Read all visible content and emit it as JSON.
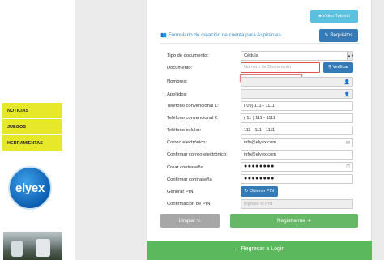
{
  "menu": {
    "items": [
      "NOTICIAS",
      "JUEGOS",
      "HERRAMIENTAS"
    ]
  },
  "logo": {
    "text": "elyex"
  },
  "header": {
    "video_label": "Video Tutorial",
    "title": "Formulario de creación de cuenta para Aspirantes",
    "requisitos_label": "Requisitos"
  },
  "form": {
    "tipo_documento": {
      "label": "Tipo de documento:",
      "value": "Cédula"
    },
    "documento": {
      "label": "Documento:",
      "placeholder": "Número de Documento",
      "verify_label": "Verificar"
    },
    "nombres": {
      "label": "Nombres:"
    },
    "apellidos": {
      "label": "Apellidos:"
    },
    "telefono1": {
      "label": "Teléfono convencional 1:",
      "value": "( 09) 111 - 1111"
    },
    "telefono2": {
      "label": "Teléfono convencional 2:",
      "value": "( 11 ) 111 - 1111"
    },
    "celular": {
      "label": "Teléfono celular:",
      "value": "111 - 111 - 1111"
    },
    "correo": {
      "label": "Correo electrónico:",
      "value": "info@elyex.com"
    },
    "confirmar_correo": {
      "label": "Confirmar correo electrónico:",
      "value": "info@elyex.com"
    },
    "password": {
      "label": "Crear contraseña",
      "value": "●●●●●●●●"
    },
    "confirmar_password": {
      "label": "Confirmar contraseña",
      "value": "●●●●●●●●"
    },
    "pin": {
      "label": "Generar PIN",
      "button_label": "Obtener PIN"
    },
    "confirmar_pin": {
      "label": "Confirmación de PIN",
      "placeholder": "Ingrese el PIN"
    }
  },
  "actions": {
    "limpiar_label": "Limpiar",
    "registrarme_label": "Registrarme",
    "regresar_label": "Regresar a Login"
  },
  "colors": {
    "menu_yellow": "#e8e82a",
    "primary_blue": "#337ab7",
    "info_blue": "#5bc0de",
    "success_green": "#5cb85c",
    "title_blue": "#3d8dc6"
  },
  "icons": [
    "video-icon",
    "users-icon",
    "edit-icon",
    "search-icon",
    "user-icon",
    "envelope-icon",
    "key-icon",
    "refresh-icon",
    "arrow-right-icon",
    "arrow-left-icon"
  ]
}
